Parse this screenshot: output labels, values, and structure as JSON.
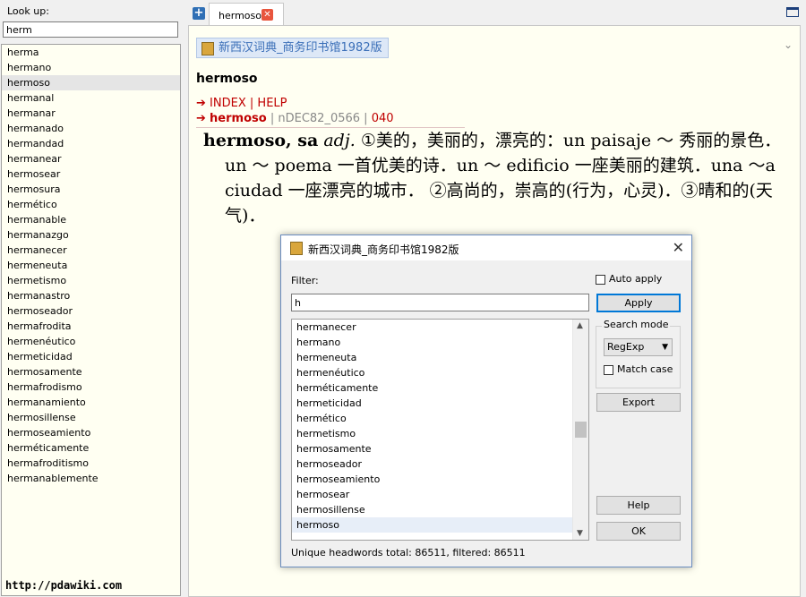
{
  "lookup": {
    "label": "Look up:",
    "value": "herm",
    "words": [
      "herma",
      "hermano",
      "hermoso",
      "hermanal",
      "hermanar",
      "hermanado",
      "hermandad",
      "hermanear",
      "hermosear",
      "hermosura",
      "hermético",
      "hermanable",
      "hermanazgo",
      "hermanecer",
      "hermeneuta",
      "hermetismo",
      "hermanastro",
      "hermoseador",
      "hermafrodita",
      "hermenéutico",
      "hermeticidad",
      "hermosamente",
      "hermafrodismo",
      "hermanamiento",
      "hermosillense",
      "hermoseamiento",
      "herméticamente",
      "hermafroditismo",
      "hermanablemente"
    ],
    "selected_index": 2
  },
  "footer": {
    "url": "http://pdawiki.com"
  },
  "tab": {
    "label": "hermoso",
    "add_glyph": "+",
    "close_glyph": "✕"
  },
  "article": {
    "dict_name": "新西汉词典_商务印书馆1982版",
    "collapse_glyph": "⌄",
    "headword": "hermoso",
    "nav": {
      "arrow": "➔",
      "index": "INDEX",
      "sep": "|",
      "help": "HELP"
    },
    "ref": {
      "arrow": "➔",
      "word": "hermoso",
      "code": "nDEC82_0566",
      "page": "040"
    },
    "entry": {
      "head": "hermoso, sa",
      "pos": "adj.",
      "text": "①美的，美丽的，漂亮的：un paisaje ～ 秀丽的景色．un ～ poema 一首优美的诗．un ～ edificio 一座美丽的建筑．una ～a ciudad 一座漂亮的城市． ②高尚的，崇高的(行为，心灵)．③晴和的(天气)．"
    }
  },
  "dialog": {
    "title": "新西汉词典_商务印书馆1982版",
    "close_glyph": "✕",
    "filter_label": "Filter:",
    "filter_value": "h",
    "auto_apply_label": "Auto apply",
    "apply_label": "Apply",
    "search_mode_label": "Search mode",
    "mode_value": "RegExp",
    "match_case_label": "Match case",
    "export_label": "Export",
    "help_label": "Help",
    "ok_label": "OK",
    "results": [
      "hermanecer",
      "hermano",
      "hermeneuta",
      "hermenéutico",
      "herméticamente",
      "hermeticidad",
      "hermético",
      "hermetismo",
      "hermosamente",
      "hermoseador",
      "hermoseamiento",
      "hermosear",
      "hermosillense",
      "hermoso"
    ],
    "selected_index": 13,
    "status": "Unique headwords total: 86511, filtered: 86511"
  }
}
